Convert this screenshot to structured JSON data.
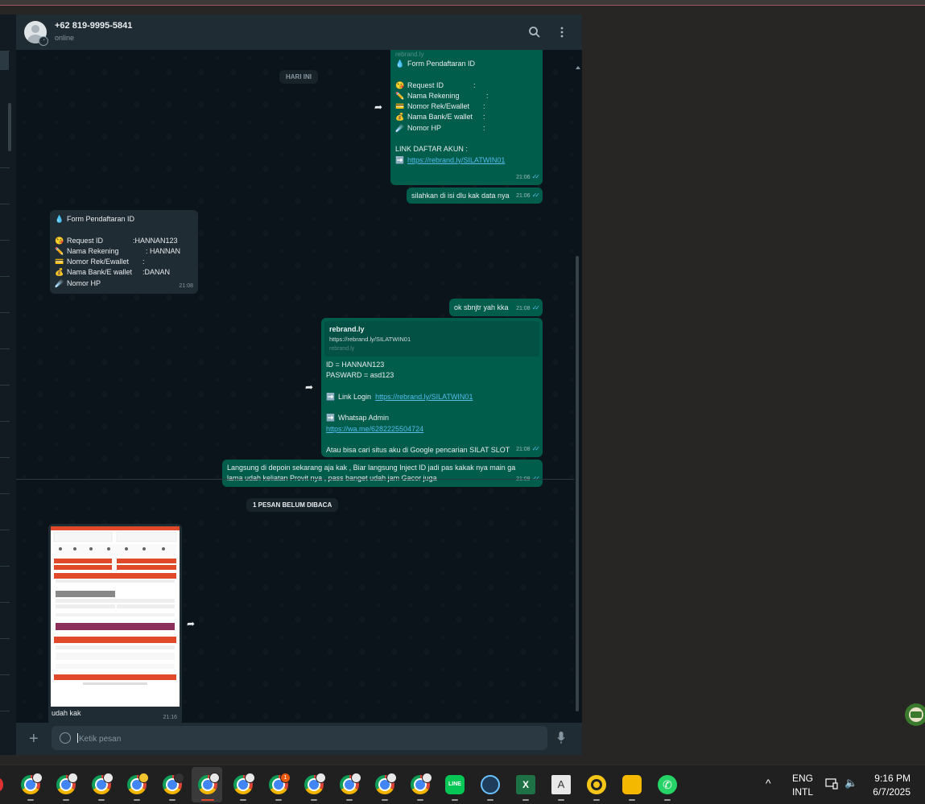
{
  "header": {
    "contact_name": "+62 819-9995-5841",
    "contact_status": "online"
  },
  "chat": {
    "date_chip": "HARI INI",
    "form_out": {
      "sender_partial": "rebrand.ly",
      "title": "Form Pendaftaran ID",
      "fields": [
        {
          "emoji": "😘",
          "label": "Request ID",
          "sep": ":"
        },
        {
          "emoji": "✏️",
          "label": "Nama Rekening",
          "sep": ":"
        },
        {
          "emoji": "💳",
          "label": "Nomor Rek/Ewallet",
          "sep": ":"
        },
        {
          "emoji": "💰",
          "label": "Nama Bank/E wallet",
          "sep": ":"
        },
        {
          "emoji": "☄️",
          "label": "Nomor HP",
          "sep": ":"
        }
      ],
      "link_heading": "LINK DAFTAR AKUN :",
      "link_arrow": "➡️",
      "link": "https://rebrand.ly/SILATWIN01",
      "time": "21:06"
    },
    "msg_fill": {
      "text": "silahkan di isi dlu kak data nya",
      "time": "21:06"
    },
    "form_in": {
      "title": "Form Pendaftaran ID",
      "fields": [
        {
          "emoji": "😘",
          "label": "Request ID",
          "value": ":HANNAN123"
        },
        {
          "emoji": "✏️",
          "label": "Nama Rekening",
          "value": ": HANNAN"
        },
        {
          "emoji": "💳",
          "label": "Nomor Rek/Ewallet",
          "value": ":"
        },
        {
          "emoji": "💰",
          "label": "Nama Bank/E wallet",
          "value": ":DANAN"
        },
        {
          "emoji": "☄️",
          "label": "Nomor HP",
          "value": ""
        }
      ],
      "time": "21:08"
    },
    "msg_ok": {
      "text": "ok sbnjtr yah kka",
      "time": "21:08"
    },
    "msg_login": {
      "preview_title": "rebrand.ly",
      "preview_url": "https://rebrand.ly/SILATWIN01",
      "preview_domain": "rebrand.ly",
      "id_line": "ID = HANNAN123",
      "pw_line": "PASWARD = asd123",
      "login_label": "Link Login",
      "login_link": "https://rebrand.ly/SILATWIN01",
      "wa_label": "Whatsap Admin",
      "wa_link": "https://wa.me/6282225504724",
      "search_line": "Atau bisa cari situs aku di Google pencarian SILAT SLOT",
      "arrow": "➡️",
      "time": "21:08"
    },
    "msg_depo": {
      "line1": "Langsung di depoin sekarang aja kak , Biar langsung Inject ID jadi pas kakak nya main ga",
      "line2": "lama udah keliatan Provit nya , pass banget udah jam Gacor juga",
      "time": "21:08"
    },
    "unread_chip": "1 PESAN BELUM DIBACA",
    "img_msg": {
      "caption": "udah kak",
      "time": "21:16"
    }
  },
  "footer": {
    "placeholder": "Ketik pesan"
  },
  "taskbar": {
    "lang_top": "ENG",
    "lang_bottom": "INTL",
    "time": "9:16 PM",
    "date": "6/7/2025",
    "badge": "1"
  },
  "colors": {
    "outgoing": "#005c4b",
    "incoming": "#202c33",
    "link": "#53bdeb",
    "chat_bg": "#0b141a"
  }
}
